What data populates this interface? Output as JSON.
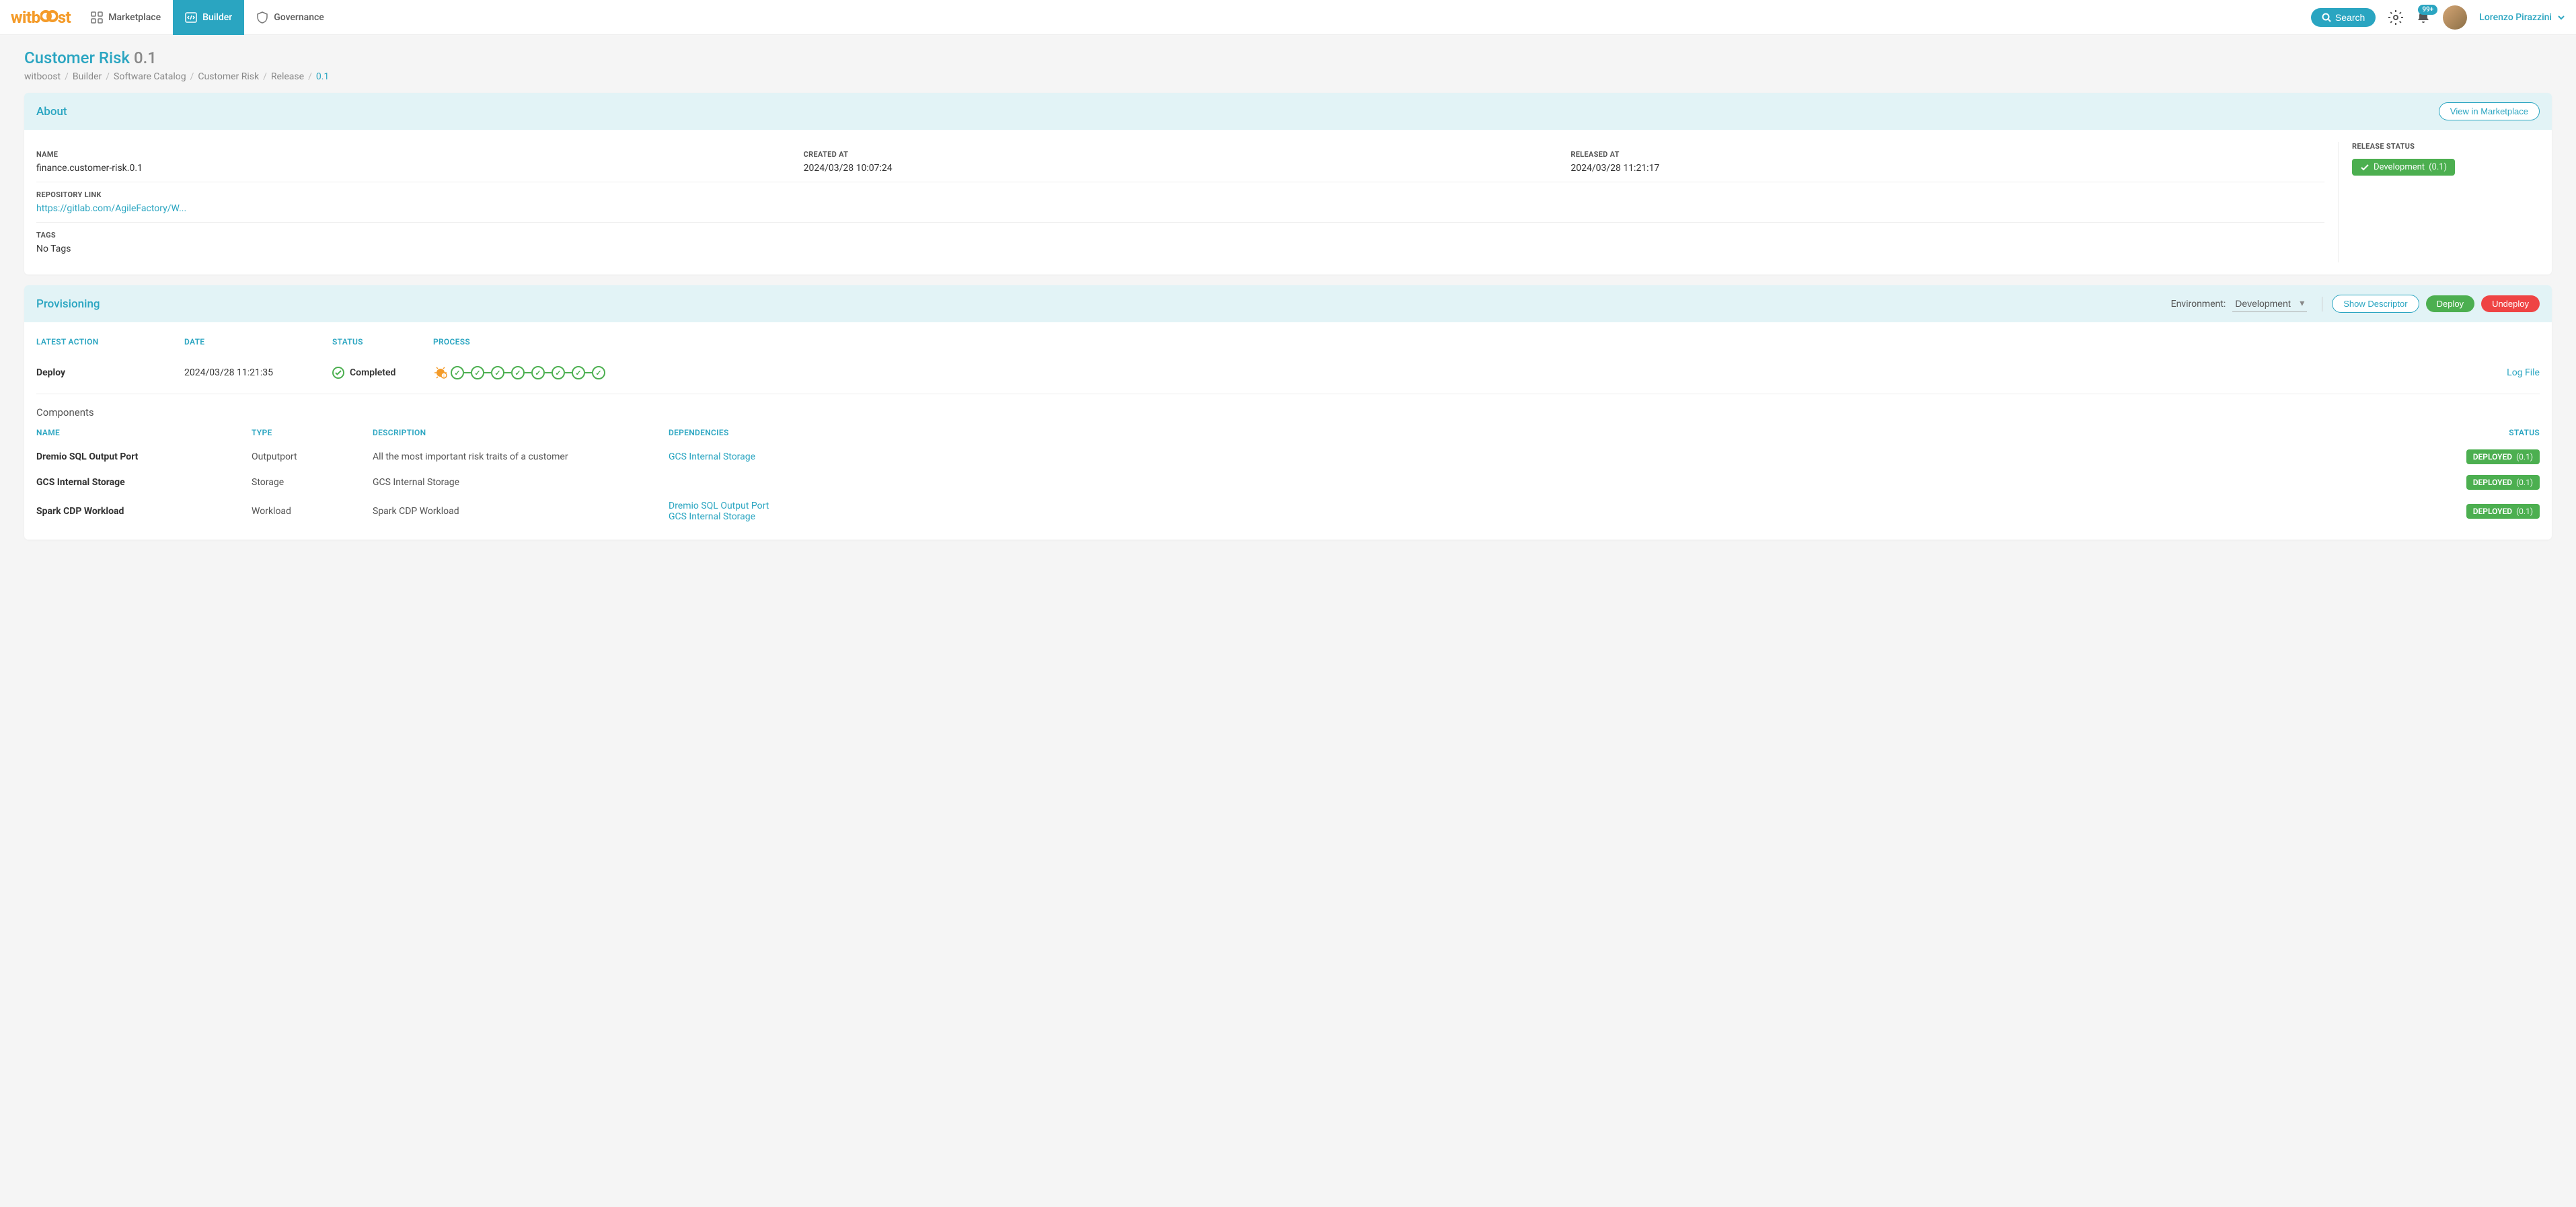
{
  "header": {
    "logo": "witboost",
    "nav": [
      {
        "label": "Marketplace",
        "icon": "grid-icon"
      },
      {
        "label": "Builder",
        "icon": "code-icon"
      },
      {
        "label": "Governance",
        "icon": "shield-icon"
      }
    ],
    "search_label": "Search",
    "notification_badge": "99+",
    "user_name": "Lorenzo Pirazzini"
  },
  "page": {
    "title_name": "Customer Risk",
    "title_version": "0.1"
  },
  "breadcrumb": [
    "witboost",
    "Builder",
    "Software Catalog",
    "Customer Risk",
    "Release",
    "0.1"
  ],
  "about": {
    "title": "About",
    "view_marketplace_label": "View in Marketplace",
    "fields": {
      "name_label": "NAME",
      "name_value": "finance.customer-risk.0.1",
      "created_label": "CREATED AT",
      "created_value": "2024/03/28 10:07:24",
      "released_label": "RELEASED AT",
      "released_value": "2024/03/28 11:21:17",
      "repo_label": "REPOSITORY LINK",
      "repo_value": "https://gitlab.com/AgileFactory/W...",
      "tags_label": "TAGS",
      "tags_value": "No Tags",
      "release_status_label": "RELEASE STATUS",
      "release_status_value": "Development",
      "release_status_version": "(0.1)"
    }
  },
  "provisioning": {
    "title": "Provisioning",
    "env_label": "Environment:",
    "env_value": "Development",
    "show_descriptor_label": "Show Descriptor",
    "deploy_label": "Deploy",
    "undeploy_label": "Undeploy",
    "headers": {
      "action": "LATEST ACTION",
      "date": "DATE",
      "status": "STATUS",
      "process": "PROCESS"
    },
    "row": {
      "action": "Deploy",
      "date": "2024/03/28 11:21:35",
      "status": "Completed",
      "log_label": "Log File"
    },
    "components_title": "Components",
    "comp_headers": {
      "name": "NAME",
      "type": "TYPE",
      "desc": "DESCRIPTION",
      "dep": "DEPENDENCIES",
      "status": "STATUS"
    },
    "components": [
      {
        "name": "Dremio SQL Output Port",
        "type": "Outputport",
        "desc": "All the most important risk traits of a customer",
        "deps": [
          "GCS Internal Storage"
        ],
        "status": "DEPLOYED",
        "version": "(0.1)"
      },
      {
        "name": "GCS Internal Storage",
        "type": "Storage",
        "desc": "GCS Internal Storage",
        "deps": [],
        "status": "DEPLOYED",
        "version": "(0.1)"
      },
      {
        "name": "Spark CDP Workload",
        "type": "Workload",
        "desc": "Spark CDP Workload",
        "deps": [
          "Dremio SQL Output Port",
          "GCS Internal Storage"
        ],
        "status": "DEPLOYED",
        "version": "(0.1)"
      }
    ]
  }
}
